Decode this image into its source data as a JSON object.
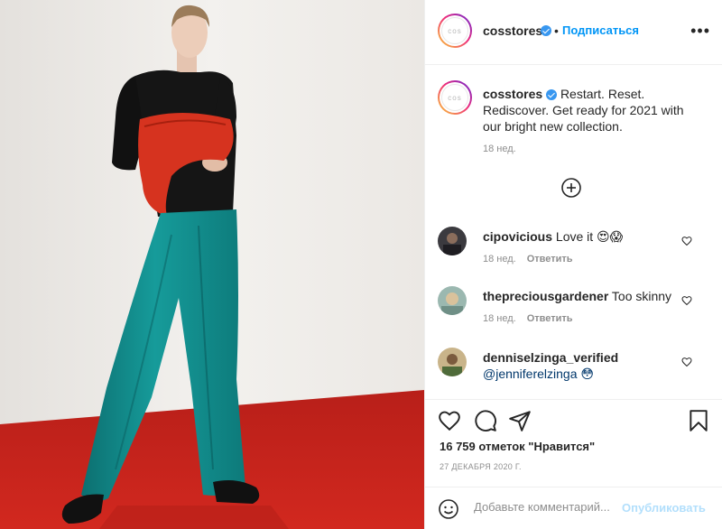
{
  "post": {
    "username": "cosstores",
    "avatar_text": "cos",
    "follow_label": "Подписаться",
    "separator": "•",
    "more_label": "•••"
  },
  "caption": {
    "username": "cosstores",
    "text": "Restart. Reset. Rediscover. Get ready for 2021 with our bright new collection.",
    "time": "18 нед."
  },
  "comments": [
    {
      "username": "cipovicious",
      "text": "Love it 😍😱",
      "time": "18 нед.",
      "reply": "Ответить"
    },
    {
      "username": "thepreciousgardener",
      "text": "Too skinny",
      "time": "18 нед.",
      "reply": "Ответить"
    },
    {
      "username": "denniselzinga_verified",
      "text": "@jenniferelzinga 😳",
      "time": "",
      "reply": ""
    }
  ],
  "footer": {
    "likes": "16 759 отметок \"Нравится\"",
    "date": "27 ДЕКАБРЯ 2020 Г.",
    "comment_placeholder": "Добавьте комментарий...",
    "publish_label": "Опубликовать"
  },
  "icons": {
    "like": "heart-icon",
    "comment": "comment-icon",
    "share": "share-icon",
    "save": "bookmark-icon",
    "emoji": "emoji-icon",
    "load_more": "plus-circle-icon",
    "verified": "verified-badge-icon"
  },
  "colors": {
    "follow": "#0095f6",
    "verified": "#3897f0",
    "floor": "#c8231c",
    "trousers": "#128c8c",
    "bag": "#d9331f"
  }
}
